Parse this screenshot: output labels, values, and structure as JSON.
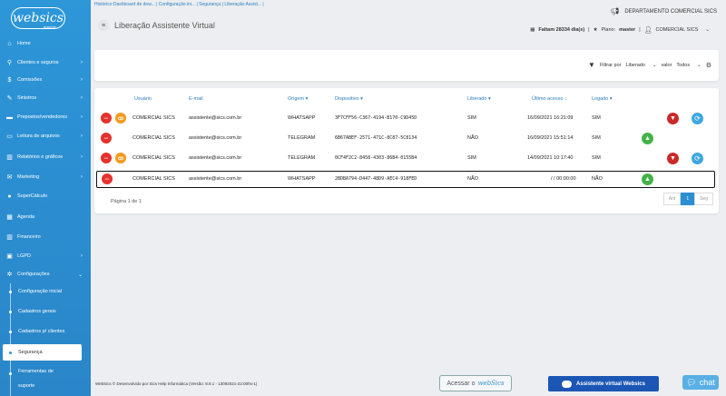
{
  "sidebar": {
    "logo": "websics",
    "logo_sub": "master",
    "items": [
      {
        "label": "Home",
        "icon": "home-icon"
      },
      {
        "label": "Clientes e seguros",
        "icon": "search-icon"
      },
      {
        "label": "Comissões",
        "icon": "dollar-icon"
      },
      {
        "label": "Sinistros",
        "icon": "wrench-icon"
      },
      {
        "label": "Prepostos/vendedores",
        "icon": "briefcase-icon"
      },
      {
        "label": "Leitura de arquivos",
        "icon": "folder-icon"
      },
      {
        "label": "Relatórios e gráficos",
        "icon": "chart-icon"
      },
      {
        "label": "Marketing",
        "icon": "envelope-icon"
      },
      {
        "label": "SuperCálculo",
        "icon": "calculator-icon"
      },
      {
        "label": "Agenda",
        "icon": "calendar-icon"
      },
      {
        "label": "Financeiro",
        "icon": "bank-icon"
      },
      {
        "label": "LGPD",
        "icon": "lock-icon"
      },
      {
        "label": "Configurações",
        "icon": "gear-icon"
      }
    ],
    "subitems": [
      {
        "label": "Configuração inicial"
      },
      {
        "label": "Cadastros gerais"
      },
      {
        "label": "Cadastros p/ clientes"
      },
      {
        "label": "Segurança"
      },
      {
        "label": "Ferramentas de"
      },
      {
        "label": "suporte"
      }
    ]
  },
  "breadcrumb": "Histórico:Dashboard de dow... | Configuração ini... | Segurança | Liberação Assist... |",
  "header": {
    "department": "DEPARTAMENTO COMERCIAL SICS",
    "title": "Liberação Assistente Virtual",
    "faltam": "Faltam 28334 dia(s)",
    "plano_label": "Plano:",
    "plano_value": "master",
    "user": "COMERCIAL SICS"
  },
  "filter": {
    "filtrar_por": "Filtrar por",
    "field": "Liberado",
    "valor_label": "valor",
    "value": "Todos"
  },
  "table": {
    "columns": [
      "Usuário",
      "E-mail",
      "Origem",
      "Dispositivo",
      "Liberado",
      "Último acesso",
      "Logado"
    ],
    "rows": [
      {
        "usuario": "COMERCIAL SICS",
        "email": "assistente@sics.com.br",
        "origem": "WHATSAPP",
        "dispositivo": "3F7CFF56-C367-4194-B170-C9D45D",
        "liberado": "SIM",
        "ultimo": "16/09/2021 16:21:09",
        "logado": "SIM",
        "action": "thumbs-down"
      },
      {
        "usuario": "COMERCIAL SICS",
        "email": "assistente@sics.com.br",
        "origem": "TELEGRAM",
        "dispositivo": "6B67ABEF-2571-471C-8C87-5C8134",
        "liberado": "NÃO",
        "ultimo": "16/09/2021 15:51:14",
        "logado": "SIM",
        "action": "thumbs-up"
      },
      {
        "usuario": "COMERCIAL SICS",
        "email": "assistente@sics.com.br",
        "origem": "TELEGRAM",
        "dispositivo": "0CF4F2C2-8458-4303-86B4-0155B4",
        "liberado": "SIM",
        "ultimo": "14/09/2021 10:17:40",
        "logado": "SIM",
        "action": "thumbs-down"
      },
      {
        "usuario": "COMERCIAL SICS",
        "email": "assistente@sics.com.br",
        "origem": "WHATSAPP",
        "dispositivo": "2BDBA794-D447-48D9-AEC4-918FED",
        "liberado": "NÃO",
        "ultimo": " / / 00:00:00",
        "logado": "NÃO",
        "action": "thumbs-up"
      }
    ]
  },
  "pagination": {
    "info": "Página 1 de 1",
    "prev": "Ant",
    "current": "1",
    "next": "Seg"
  },
  "footer": {
    "text": "WebSics © Desenvolvido por Sics Help Informática (Versão: 8.9.1 - 13092021-22:00hs-1)",
    "acessar": "Acessar o",
    "acessar_brand": "webSics",
    "assistente": "Assistente virtual Websics",
    "chat": "chat"
  }
}
